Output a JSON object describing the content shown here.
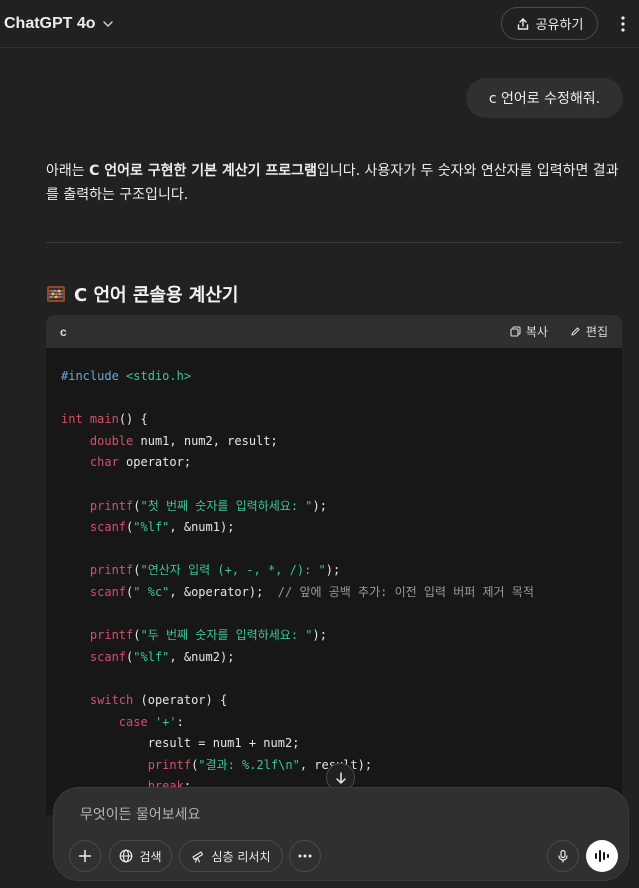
{
  "header": {
    "model_name": "ChatGPT 4o",
    "share_label": "공유하기"
  },
  "user_message": "c 언어로 수정해줘.",
  "answer": {
    "pre": "아래는 ",
    "bold": "C 언어로 구현한 기본 계산기 프로그램",
    "post": "입니다. 사용자가 두 숫자와 연산자를 입력하면 결과를 출력하는 구조입니다."
  },
  "section_title": "C 언어 콘솔용 계산기",
  "code_block": {
    "language": "c",
    "copy_label": "복사",
    "edit_label": "편집",
    "lines": [
      [
        {
          "t": "#include ",
          "c": "pp"
        },
        {
          "t": "<stdio.h>",
          "c": "str"
        }
      ],
      [],
      [
        {
          "t": "int",
          "c": "kw"
        },
        {
          "t": " ",
          "c": ""
        },
        {
          "t": "main",
          "c": "kw"
        },
        {
          "t": "() {",
          "c": ""
        }
      ],
      [
        {
          "t": "    ",
          "c": ""
        },
        {
          "t": "double",
          "c": "kw"
        },
        {
          "t": " num1, num2, result;",
          "c": ""
        }
      ],
      [
        {
          "t": "    ",
          "c": ""
        },
        {
          "t": "char",
          "c": "kw"
        },
        {
          "t": " operator;",
          "c": ""
        }
      ],
      [],
      [
        {
          "t": "    ",
          "c": ""
        },
        {
          "t": "printf",
          "c": "kw"
        },
        {
          "t": "(",
          "c": ""
        },
        {
          "t": "\"첫 번째 숫자를 입력하세요: \"",
          "c": "str"
        },
        {
          "t": ");",
          "c": ""
        }
      ],
      [
        {
          "t": "    ",
          "c": ""
        },
        {
          "t": "scanf",
          "c": "kw"
        },
        {
          "t": "(",
          "c": ""
        },
        {
          "t": "\"%lf\"",
          "c": "str"
        },
        {
          "t": ", &num1);",
          "c": ""
        }
      ],
      [],
      [
        {
          "t": "    ",
          "c": ""
        },
        {
          "t": "printf",
          "c": "kw"
        },
        {
          "t": "(",
          "c": ""
        },
        {
          "t": "\"연산자 입력 (+, -, *, /): \"",
          "c": "str"
        },
        {
          "t": ");",
          "c": ""
        }
      ],
      [
        {
          "t": "    ",
          "c": ""
        },
        {
          "t": "scanf",
          "c": "kw"
        },
        {
          "t": "(",
          "c": ""
        },
        {
          "t": "\" %c\"",
          "c": "str"
        },
        {
          "t": ", &operator);  ",
          "c": ""
        },
        {
          "t": "// 앞에 공백 추가: 이전 입력 버퍼 제거 목적",
          "c": "cm"
        }
      ],
      [],
      [
        {
          "t": "    ",
          "c": ""
        },
        {
          "t": "printf",
          "c": "kw"
        },
        {
          "t": "(",
          "c": ""
        },
        {
          "t": "\"두 번째 숫자를 입력하세요: \"",
          "c": "str"
        },
        {
          "t": ");",
          "c": ""
        }
      ],
      [
        {
          "t": "    ",
          "c": ""
        },
        {
          "t": "scanf",
          "c": "kw"
        },
        {
          "t": "(",
          "c": ""
        },
        {
          "t": "\"%lf\"",
          "c": "str"
        },
        {
          "t": ", &num2);",
          "c": ""
        }
      ],
      [],
      [
        {
          "t": "    ",
          "c": ""
        },
        {
          "t": "switch",
          "c": "kw"
        },
        {
          "t": " (operator) {",
          "c": ""
        }
      ],
      [
        {
          "t": "        ",
          "c": ""
        },
        {
          "t": "case",
          "c": "kw"
        },
        {
          "t": " ",
          "c": ""
        },
        {
          "t": "'+'",
          "c": "str"
        },
        {
          "t": ":",
          "c": ""
        }
      ],
      [
        {
          "t": "            result = num1 + num2;",
          "c": ""
        }
      ],
      [
        {
          "t": "            ",
          "c": ""
        },
        {
          "t": "printf",
          "c": "kw"
        },
        {
          "t": "(",
          "c": ""
        },
        {
          "t": "\"결과: %.2lf\\n\"",
          "c": "str"
        },
        {
          "t": ", result);",
          "c": ""
        }
      ],
      [
        {
          "t": "            ",
          "c": ""
        },
        {
          "t": "break",
          "c": "kw"
        },
        {
          "t": ";",
          "c": ""
        }
      ]
    ]
  },
  "composer": {
    "placeholder": "무엇이든 물어보세요",
    "search_label": "검색",
    "research_label": "심층 리서치"
  },
  "colors": {
    "background": "#212121",
    "code_background": "#171717",
    "keyword": "#d54f6a",
    "string": "#3ec39a",
    "preprocessor": "#62a8e0",
    "comment": "#9a9a9a"
  }
}
